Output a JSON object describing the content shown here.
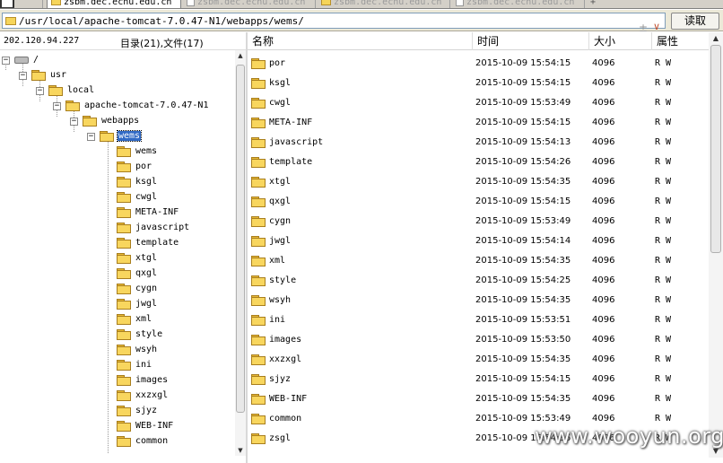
{
  "tabs": [
    {
      "label": "zsbm.dec.ecnu.edu.cn",
      "active": true
    },
    {
      "label": "zsbm.dec.ecnu.edu.cn",
      "active": false
    },
    {
      "label": "zsbm.dec.ecnu.edu.cn",
      "active": false
    },
    {
      "label": "zsbm.dec.ecnu.edu.cn",
      "active": false
    }
  ],
  "new_tab_label": "+",
  "pathbar": {
    "path": "/usr/local/apache-tomcat-7.0.47-N1/webapps/wems/",
    "plus_glyph": "±",
    "arrow_glyph": "∨",
    "read_label": "读取"
  },
  "left_info": {
    "ip": "202.120.94.227",
    "counts": "目录(21),文件(17)"
  },
  "tree": {
    "root": "/",
    "usr": "usr",
    "local": "local",
    "tomcat": "apache-tomcat-7.0.47-N1",
    "webapps": "webapps",
    "selected": "wems",
    "children": [
      "wems",
      "por",
      "ksgl",
      "cwgl",
      "META-INF",
      "javascript",
      "template",
      "xtgl",
      "qxgl",
      "cygn",
      "jwgl",
      "xml",
      "style",
      "wsyh",
      "ini",
      "images",
      "xxzxgl",
      "sjyz",
      "WEB-INF",
      "common"
    ]
  },
  "list": {
    "headers": {
      "name": "名称",
      "time": "时间",
      "size": "大小",
      "attr": "属性"
    },
    "rows": [
      {
        "name": "por",
        "time": "2015-10-09 15:54:15",
        "size": "4096",
        "attr": "R W"
      },
      {
        "name": "ksgl",
        "time": "2015-10-09 15:54:15",
        "size": "4096",
        "attr": "R W"
      },
      {
        "name": "cwgl",
        "time": "2015-10-09 15:53:49",
        "size": "4096",
        "attr": "R W"
      },
      {
        "name": "META-INF",
        "time": "2015-10-09 15:54:15",
        "size": "4096",
        "attr": "R W"
      },
      {
        "name": "javascript",
        "time": "2015-10-09 15:54:13",
        "size": "4096",
        "attr": "R W"
      },
      {
        "name": "template",
        "time": "2015-10-09 15:54:26",
        "size": "4096",
        "attr": "R W"
      },
      {
        "name": "xtgl",
        "time": "2015-10-09 15:54:35",
        "size": "4096",
        "attr": "R W"
      },
      {
        "name": "qxgl",
        "time": "2015-10-09 15:54:15",
        "size": "4096",
        "attr": "R W"
      },
      {
        "name": "cygn",
        "time": "2015-10-09 15:53:49",
        "size": "4096",
        "attr": "R W"
      },
      {
        "name": "jwgl",
        "time": "2015-10-09 15:54:14",
        "size": "4096",
        "attr": "R W"
      },
      {
        "name": "xml",
        "time": "2015-10-09 15:54:35",
        "size": "4096",
        "attr": "R W"
      },
      {
        "name": "style",
        "time": "2015-10-09 15:54:25",
        "size": "4096",
        "attr": "R W"
      },
      {
        "name": "wsyh",
        "time": "2015-10-09 15:54:35",
        "size": "4096",
        "attr": "R W"
      },
      {
        "name": "ini",
        "time": "2015-10-09 15:53:51",
        "size": "4096",
        "attr": "R W"
      },
      {
        "name": "images",
        "time": "2015-10-09 15:53:50",
        "size": "4096",
        "attr": "R W"
      },
      {
        "name": "xxzxgl",
        "time": "2015-10-09 15:54:35",
        "size": "4096",
        "attr": "R W"
      },
      {
        "name": "sjyz",
        "time": "2015-10-09 15:54:15",
        "size": "4096",
        "attr": "R W"
      },
      {
        "name": "WEB-INF",
        "time": "2015-10-09 15:54:35",
        "size": "4096",
        "attr": "R W"
      },
      {
        "name": "common",
        "time": "2015-10-09 15:53:49",
        "size": "4096",
        "attr": "R W"
      },
      {
        "name": "zsgl",
        "time": "2015-10-09 15:54:36",
        "size": "4096",
        "attr": "R W"
      }
    ]
  },
  "watermark": "www.wooyun.org",
  "colors": {
    "selection": "#316ac5",
    "folder": "#f8d65e",
    "chrome": "#ece9d8"
  },
  "icons": {
    "folder": "folder-icon",
    "drive": "drive-icon",
    "expander": "tree-expander-icon"
  }
}
